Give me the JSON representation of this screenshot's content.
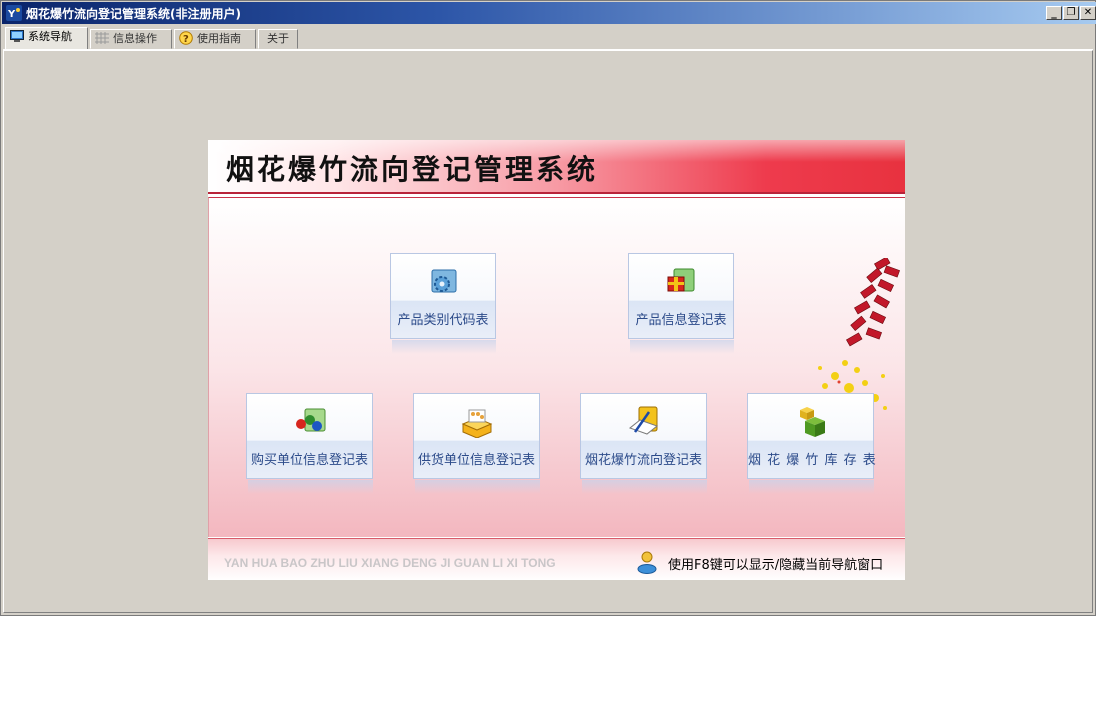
{
  "window": {
    "title": "烟花爆竹流向登记管理系统(非注册用户)",
    "controls": {
      "minimize": "_",
      "restore": "❐",
      "close": "✕"
    }
  },
  "tabs": [
    {
      "label": "系统导航",
      "icon": "monitor-icon",
      "active": true
    },
    {
      "label": "信息操作",
      "icon": "grid-icon",
      "active": false
    },
    {
      "label": "使用指南",
      "icon": "help-icon",
      "active": false
    },
    {
      "label": "关于",
      "icon": "",
      "active": false
    }
  ],
  "nav": {
    "title": "烟花爆竹流向登记管理系统",
    "buttons": [
      {
        "label": "产品类别代码表",
        "icon": "gear-folder-icon"
      },
      {
        "label": "产品信息登记表",
        "icon": "gift-folder-icon"
      },
      {
        "label": "购买单位信息登记表",
        "icon": "people-folder-icon"
      },
      {
        "label": "供货单位信息登记表",
        "icon": "box-icon"
      },
      {
        "label": "烟花爆竹流向登记表",
        "icon": "document-pen-icon"
      },
      {
        "label": "烟 花 爆 竹 库 存 表",
        "icon": "cubes-icon"
      }
    ],
    "pinyin": "YAN HUA BAO ZHU LIU XIANG DENG JI GUAN LI XI TONG",
    "hint": "使用F8键可以显示/隐藏当前导航窗口"
  },
  "colors": {
    "title_bar": "#0a246a",
    "header_red": "#e8323f",
    "button_text": "#2c4b8a",
    "window_bg": "#d4d0c8"
  }
}
